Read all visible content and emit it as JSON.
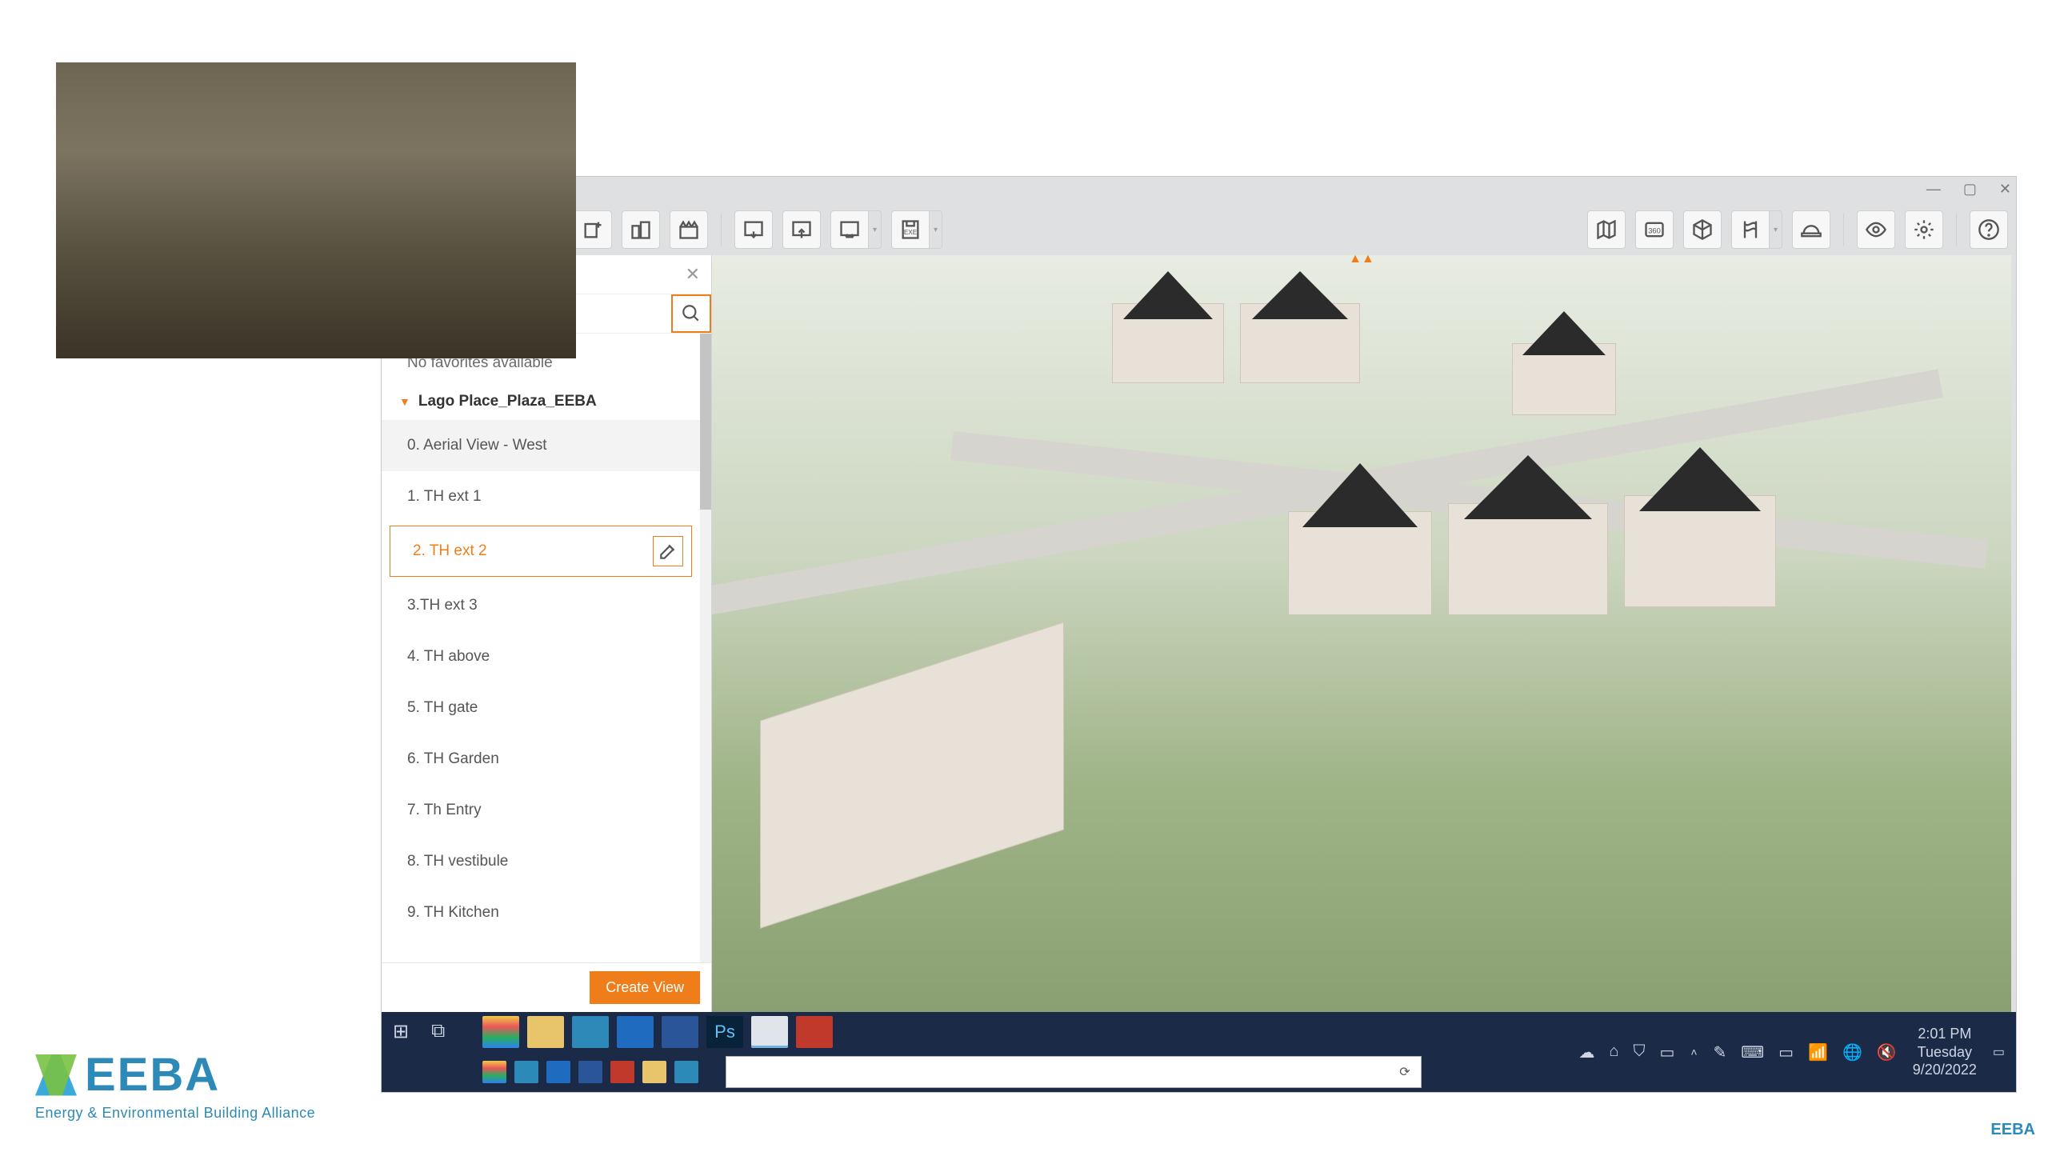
{
  "webcam": {
    "alt": "Presenter camera feed"
  },
  "eeba": {
    "name": "EEBA",
    "tagline": "Energy & Environmental Building Alliance"
  },
  "window": {
    "minimize_name": "minimize",
    "maximize_name": "maximize",
    "close_name": "close"
  },
  "toolbar_left": [
    {
      "name": "add-model-icon"
    },
    {
      "name": "buildings-icon"
    },
    {
      "name": "clapper-icon"
    },
    {
      "sep": true
    },
    {
      "name": "import-view-icon"
    },
    {
      "name": "export-view-icon"
    },
    {
      "name": "transfer-icon",
      "dropdown": true
    },
    {
      "name": "save-view-icon",
      "dropdown": true
    }
  ],
  "toolbar_right": [
    {
      "name": "map-icon"
    },
    {
      "name": "360-icon"
    },
    {
      "name": "cube-icon"
    },
    {
      "name": "maps-pin-icon",
      "dropdown": true
    },
    {
      "name": "hardhat-icon"
    },
    {
      "sep": true
    },
    {
      "name": "visibility-icon"
    },
    {
      "name": "settings-icon"
    },
    {
      "sep": true
    },
    {
      "name": "help-icon"
    }
  ],
  "views_panel": {
    "search_placeholder": "",
    "no_favorites": "No favorites available",
    "model_name": "Lago Place_Plaza_EEBA",
    "items": [
      {
        "label": "0. Aerial View - West",
        "state": "hover"
      },
      {
        "label": "1. TH ext 1"
      },
      {
        "label": "2. TH ext 2",
        "state": "selected"
      },
      {
        "label": "3.TH ext 3"
      },
      {
        "label": "4. TH above"
      },
      {
        "label": "5. TH gate"
      },
      {
        "label": "6. TH Garden"
      },
      {
        "label": "7. Th Entry"
      },
      {
        "label": "8. TH vestibule"
      },
      {
        "label": "9. TH Kitchen"
      }
    ],
    "create_label": "Create View"
  },
  "taskbar": {
    "apps_row1": [
      {
        "name": "chrome-icon",
        "class": "chrome"
      },
      {
        "name": "file-explorer-icon",
        "class": "explorer"
      },
      {
        "name": "ms-store-icon",
        "class": "store"
      },
      {
        "name": "outlook-icon",
        "class": "outlook"
      },
      {
        "name": "word-icon",
        "class": "word"
      },
      {
        "name": "photoshop-icon",
        "class": "ps",
        "text": "Ps"
      },
      {
        "name": "sketchup-icon",
        "class": "sketchup"
      },
      {
        "name": "powerpoint-icon",
        "class": "ppt"
      }
    ],
    "apps_row2_mini": [
      {
        "name": "chrome-mini-icon",
        "class": "chrome"
      },
      {
        "name": "edge-mini-icon",
        "class": "store"
      },
      {
        "name": "mail-mini-icon",
        "class": "outlook"
      },
      {
        "name": "excel-mini-icon",
        "class": "word"
      },
      {
        "name": "close-mini-icon",
        "class": "ppt"
      },
      {
        "name": "explorer-mini-icon",
        "class": "explorer"
      },
      {
        "name": "task-mini-icon",
        "class": "store"
      }
    ],
    "tray1": [
      {
        "name": "cloud-icon",
        "glyph": "☁"
      },
      {
        "name": "teams-icon",
        "glyph": "⌂"
      },
      {
        "name": "security-icon",
        "glyph": "⛉"
      },
      {
        "name": "screen-icon",
        "glyph": "▭"
      }
    ],
    "tray2": [
      {
        "name": "pen-icon",
        "glyph": "✎"
      },
      {
        "name": "keyboard-icon",
        "glyph": "⌨"
      },
      {
        "name": "notification-icon",
        "glyph": "▭"
      },
      {
        "name": "wifi-icon",
        "glyph": "📶"
      },
      {
        "name": "globe-icon",
        "glyph": "🌐"
      },
      {
        "name": "volume-mute-icon",
        "glyph": "🔇"
      }
    ],
    "clock": {
      "time": "2:01 PM",
      "day": "Tuesday",
      "date": "9/20/2022"
    },
    "action_center_name": "action-center-icon",
    "chevron_name": "tray-chevron-icon"
  }
}
